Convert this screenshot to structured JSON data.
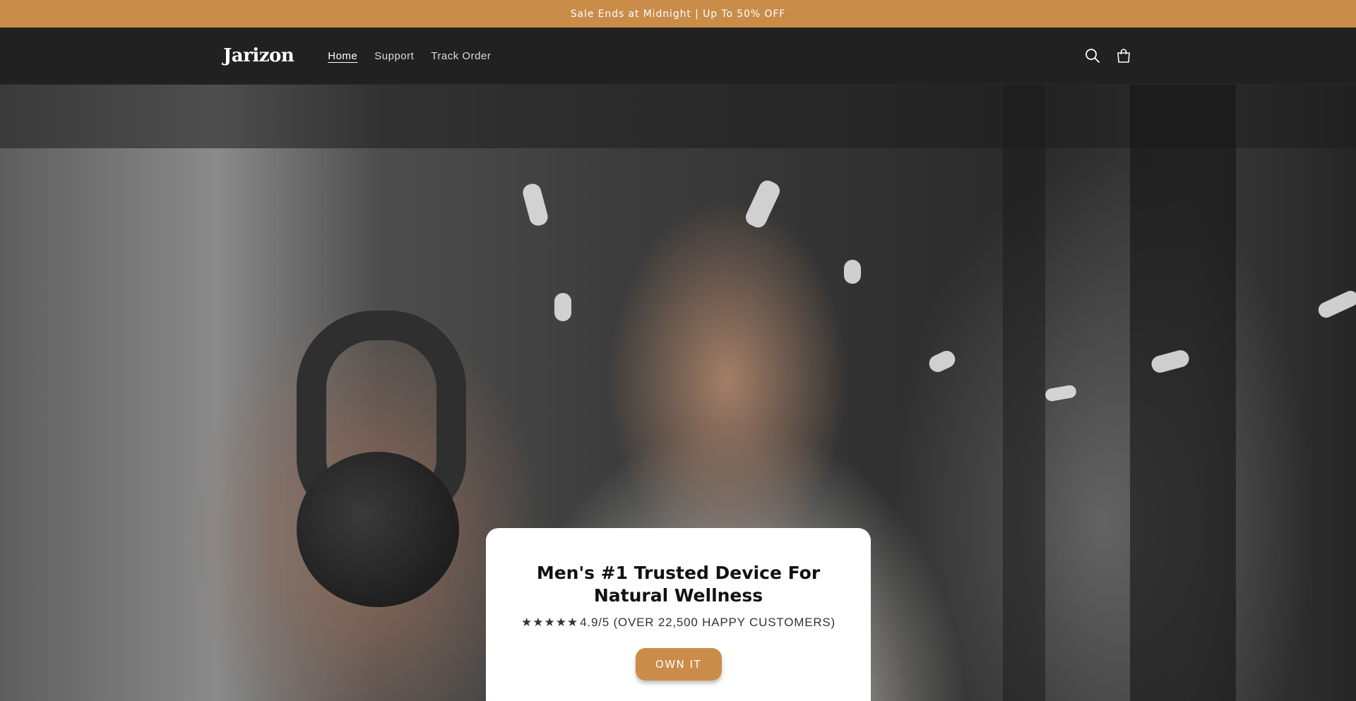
{
  "colors": {
    "announcement_bg": "#c98c49",
    "header_bg": "#212121",
    "cta_bg": "#c98c49"
  },
  "announcement": {
    "text": "Sale Ends at Midnight | Up To 50% OFF"
  },
  "header": {
    "logo": "Jarizon",
    "nav": [
      {
        "label": "Home",
        "active": true
      },
      {
        "label": "Support",
        "active": false
      },
      {
        "label": "Track Order",
        "active": false
      }
    ],
    "icons": [
      "search-icon",
      "cart-icon"
    ]
  },
  "hero": {
    "headline": "Men's #1 Trusted Device For Natural Wellness",
    "rating_stars": "★★★★★",
    "rating_text": "4.9/5 (OVER 22,500 HAPPY CUSTOMERS)",
    "cta_label": "OWN IT"
  }
}
